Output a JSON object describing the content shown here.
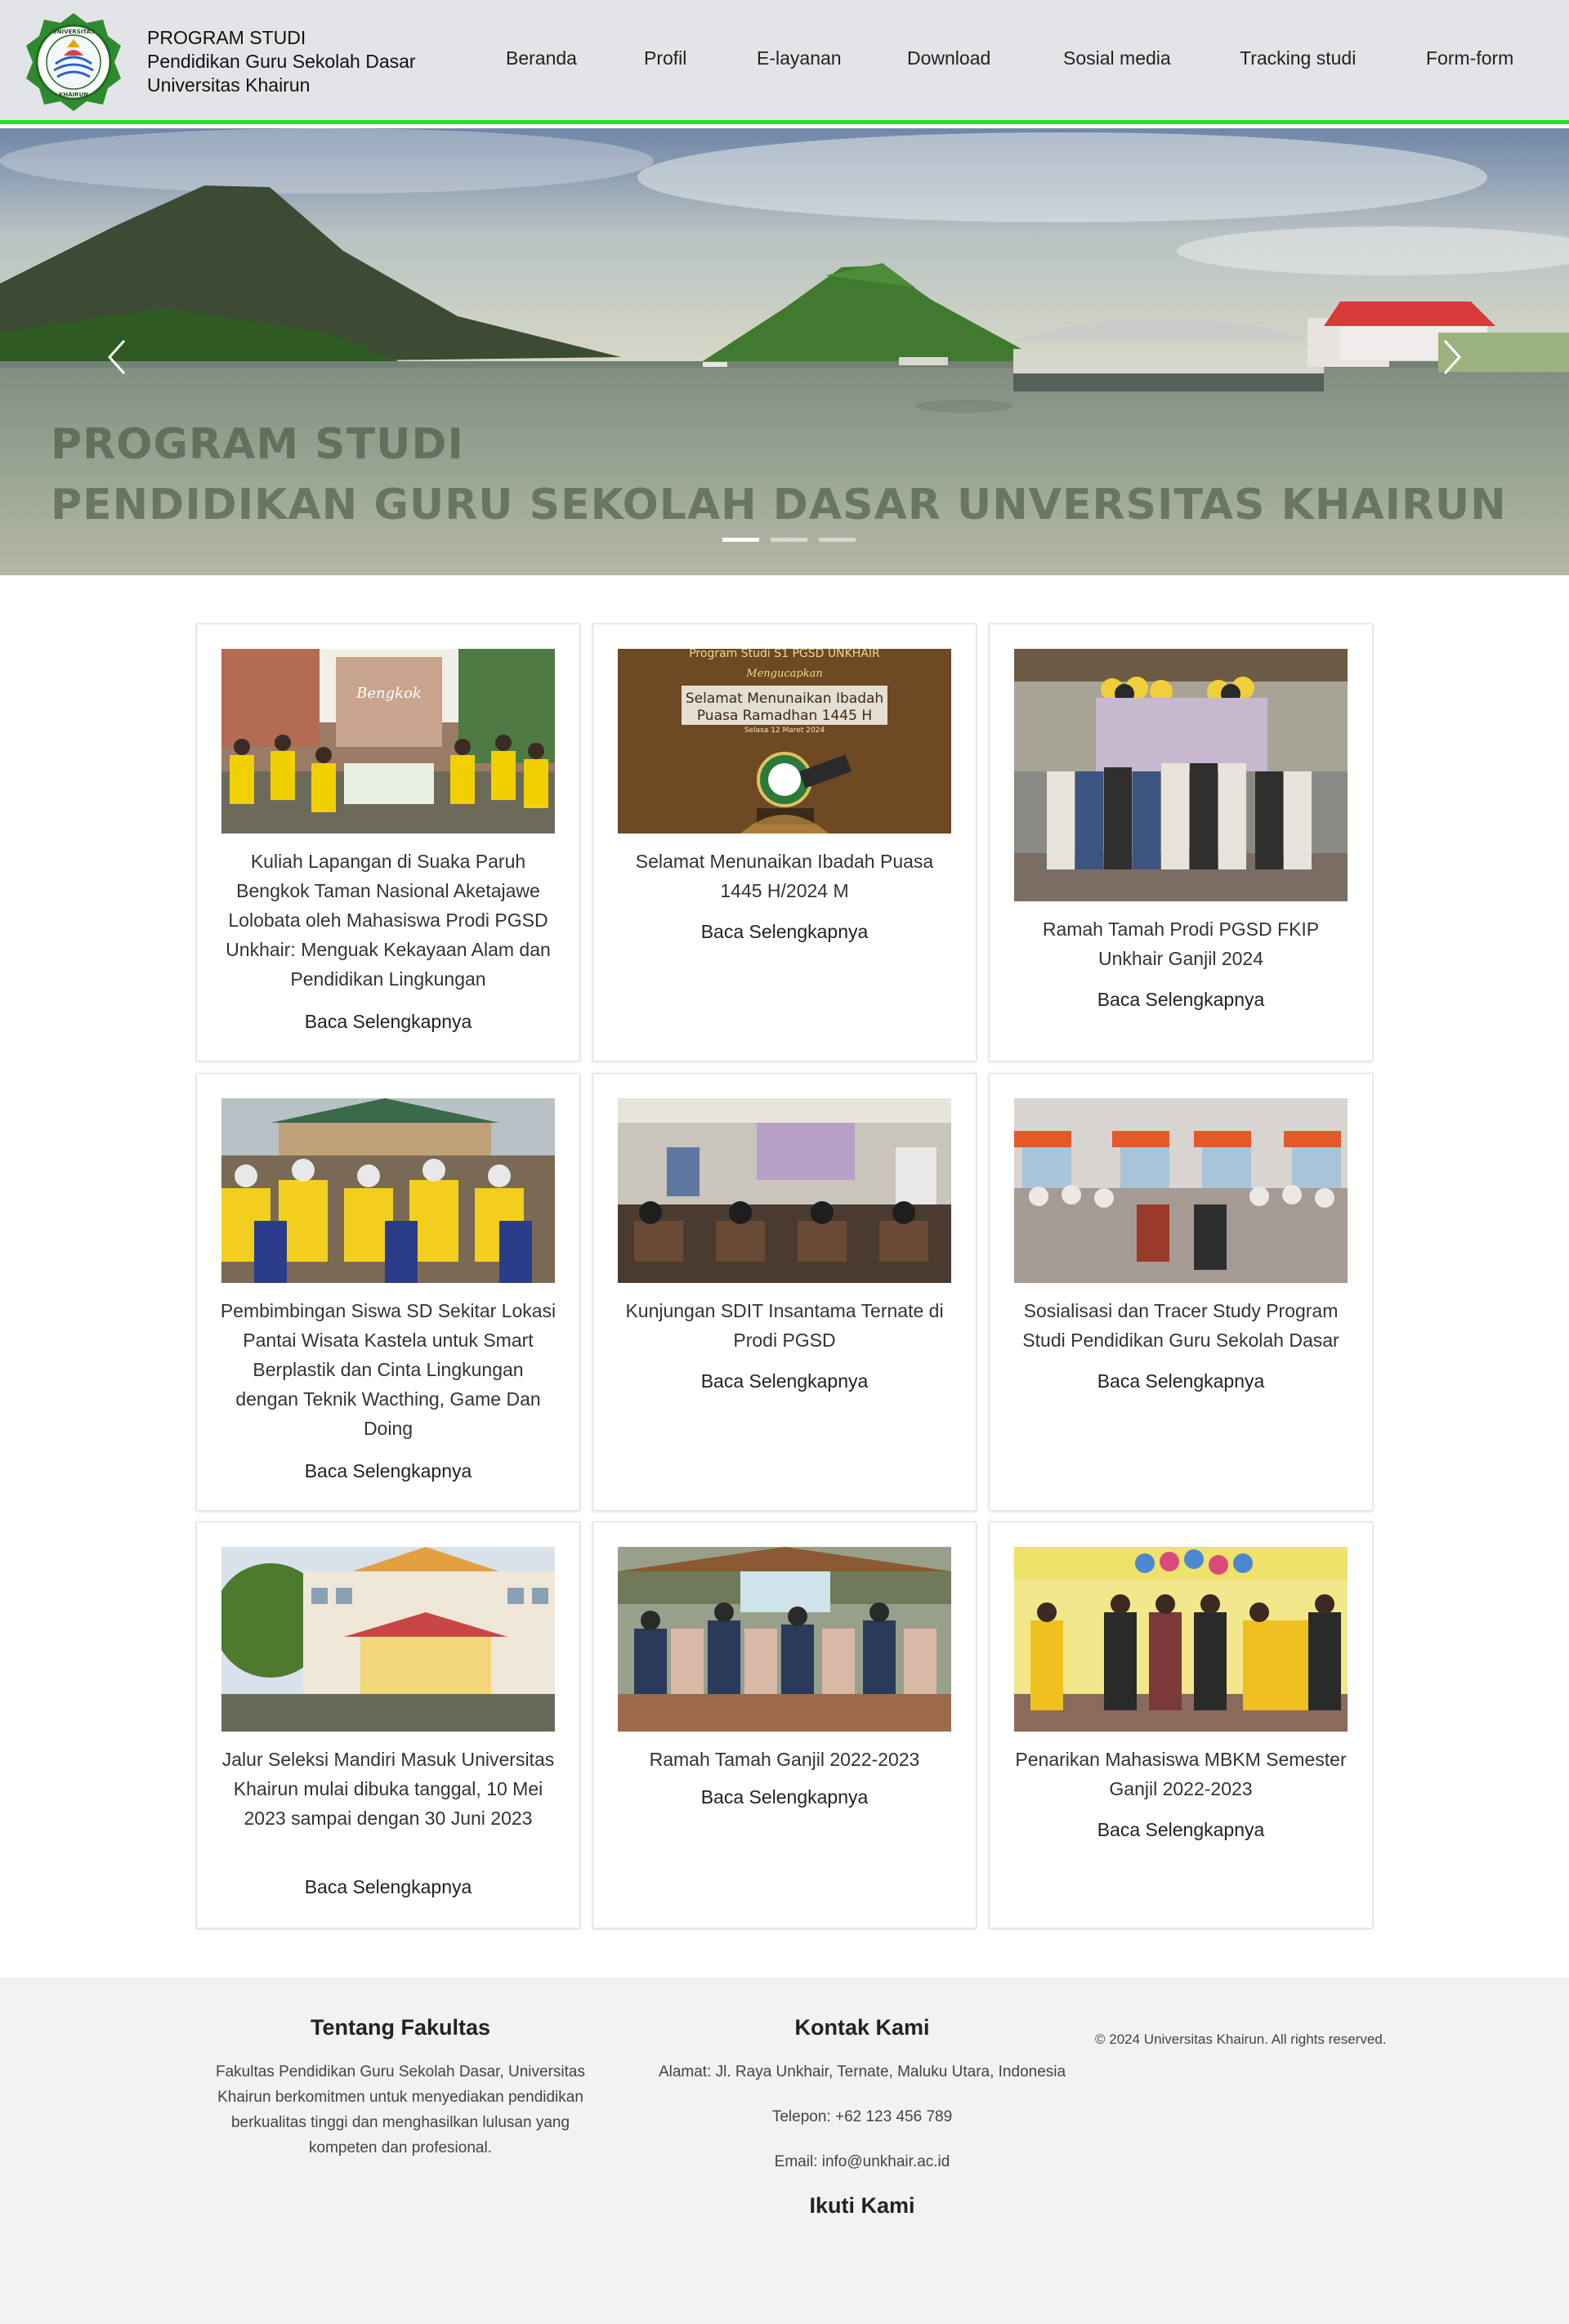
{
  "header": {
    "brand_line1": "PROGRAM STUDI",
    "brand_line2": "Pendidikan Guru Sekolah Dasar",
    "brand_line3": "Universitas Khairun",
    "logo_text_top": "UNIVERSITAS",
    "logo_text_bottom": "KHAIRUN",
    "nav": [
      "Beranda",
      "Profil",
      "E-layanan",
      "Download",
      "Sosial media",
      "Tracking studi",
      "Form-form"
    ]
  },
  "hero": {
    "caption_line1": "PROGRAM STUDI",
    "caption_line2": "PENDIDIKAN GURU SEKOLAH DASAR UNVERSITAS KHAIRUN",
    "prev_icon": "chevron-left-icon",
    "next_icon": "chevron-right-icon",
    "slides": 3,
    "active_slide": 1
  },
  "posts": [
    {
      "title": "Kuliah Lapangan di Suaka Paruh Bengkok Taman Nasional Aketajawe Lolobata oleh Mahasiswa Prodi PGSD Unkhair: Menguak Kekayaan Alam dan Pendidikan Lingkungan",
      "link": "Baca Selengkapnya",
      "sign_text": "Bengkok"
    },
    {
      "title": "Selamat Menunaikan Ibadah Puasa 1445 H/2024 M",
      "link": "Baca Selengkapnya",
      "banner_top": "Program Studi S1 PGSD UNKHAIR",
      "banner_sub": "Mengucapkan",
      "banner_main1": "Selamat Menunaikan Ibadah",
      "banner_main2": "Puasa Ramadhan 1445 H",
      "banner_date": "Selasa 12 Maret 2024"
    },
    {
      "title": "Ramah Tamah Prodi PGSD FKIP Unkhair Ganjil 2024",
      "link": "Baca Selengkapnya"
    },
    {
      "title": "Pembimbingan Siswa SD Sekitar Lokasi Pantai Wisata Kastela untuk Smart Berplastik dan Cinta Lingkungan dengan Teknik Wacthing, Game Dan Doing",
      "link": "Baca Selengkapnya"
    },
    {
      "title": "Kunjungan SDIT Insantama Ternate di Prodi PGSD",
      "link": "Baca Selengkapnya"
    },
    {
      "title": "Sosialisasi dan Tracer Study Program Studi Pendidikan Guru Sekolah Dasar",
      "link": "Baca Selengkapnya"
    },
    {
      "title": "Jalur Seleksi Mandiri Masuk Universitas Khairun mulai dibuka tanggal, 10 Mei 2023 sampai dengan 30 Juni 2023",
      "link": "Baca Selengkapnya"
    },
    {
      "title": "Ramah Tamah Ganjil 2022-2023",
      "link": "Baca Selengkapnya"
    },
    {
      "title": "Penarikan Mahasiswa MBKM Semester Ganjil 2022-2023",
      "link": "Baca Selengkapnya"
    }
  ],
  "footer": {
    "about_title": "Tentang Fakultas",
    "about_text": "Fakultas Pendidikan Guru Sekolah Dasar, Universitas Khairun berkomitmen untuk menyediakan pendidikan berkualitas tinggi dan menghasilkan lulusan yang kompeten dan profesional.",
    "contact_title": "Kontak Kami",
    "address": "Alamat: Jl. Raya Unkhair, Ternate, Maluku Utara, Indonesia",
    "phone": "Telepon: +62 123 456 789",
    "email": "Email: info@unkhair.ac.id",
    "follow_title": "Ikuti Kami",
    "copyright": "© 2024 Universitas Khairun. All rights reserved."
  }
}
